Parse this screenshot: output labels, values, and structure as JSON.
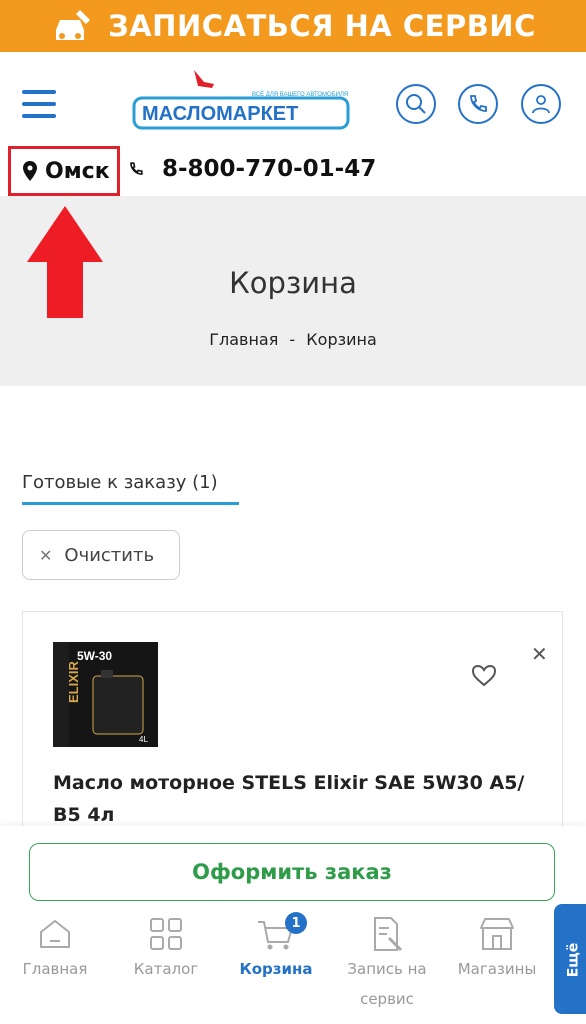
{
  "banner": {
    "text": "ЗАПИСАТЬСЯ НА СЕРВИС",
    "bg": "#f39a1e"
  },
  "header": {
    "logo_text": "МАСЛОМАРКЕТ",
    "logo_tagline": "ВСЁ ДЛЯ ВАШЕГО АВТОМОБИЛЯ"
  },
  "location": {
    "city": "Омск",
    "phone": "8-800-770-01-47"
  },
  "hero": {
    "title": "Корзина",
    "breadcrumb_home": "Главная",
    "breadcrumb_sep": "-",
    "breadcrumb_current": "Корзина"
  },
  "cart": {
    "tab_label": "Готовые к заказу (1)",
    "clear_label": "Очистить",
    "item": {
      "name": "Масло моторное STELS Elixir SAE 5W30 A5/ B5 4л",
      "image_text": "5W-30",
      "image_brand": "ELIXIR",
      "image_volume": "4L"
    }
  },
  "checkout_label": "Оформить заказ",
  "nav": [
    {
      "label": "Главная",
      "icon": "home-icon"
    },
    {
      "label": "Каталог",
      "icon": "grid-icon"
    },
    {
      "label": "Корзина",
      "icon": "cart-icon",
      "badge": "1"
    },
    {
      "label": "Запись на сервис",
      "icon": "service-icon"
    },
    {
      "label": "Магазины",
      "icon": "store-icon"
    }
  ],
  "more_label": "Ещё",
  "colors": {
    "accent": "#2472c8",
    "green": "#2e9c48",
    "highlight": "#e0202a"
  }
}
